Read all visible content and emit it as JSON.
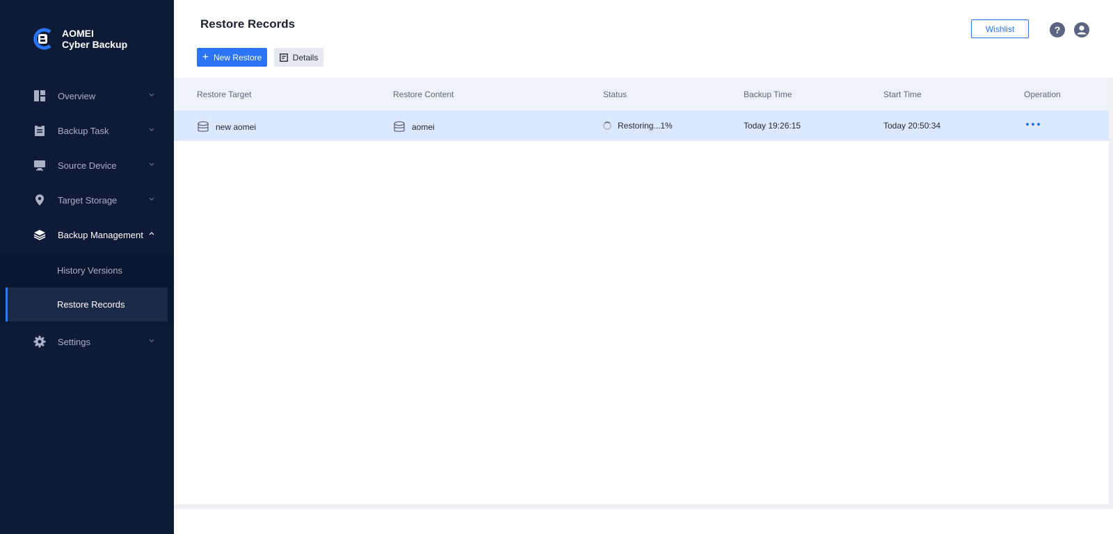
{
  "app": {
    "name_line1": "AOMEI",
    "name_line2": "Cyber Backup",
    "brand_color": "#2b73f5",
    "sidebar_bg": "#0e1a36"
  },
  "sidebar": {
    "items": [
      {
        "label": "Overview",
        "icon": "dashboard-icon"
      },
      {
        "label": "Backup Task",
        "icon": "clipboard-icon"
      },
      {
        "label": "Source Device",
        "icon": "monitor-icon"
      },
      {
        "label": "Target Storage",
        "icon": "location-pin-icon"
      },
      {
        "label": "Backup Management",
        "icon": "layers-icon",
        "expanded": true
      },
      {
        "label": "Settings",
        "icon": "gear-icon"
      }
    ],
    "subitems": [
      {
        "label": "History Versions"
      },
      {
        "label": "Restore Records",
        "active": true
      }
    ]
  },
  "header": {
    "title": "Restore Records",
    "new_restore_label": "New Restore",
    "details_label": "Details",
    "wishlist_label": "Wishlist"
  },
  "table": {
    "columns": [
      "Restore Target",
      "Restore Content",
      "Status",
      "Backup Time",
      "Start Time",
      "Operation"
    ],
    "rows": [
      {
        "restore_target": "new aomei",
        "restore_content": "aomei",
        "status": "Restoring...1%",
        "backup_time": "Today 19:26:15",
        "start_time": "Today 20:50:34"
      }
    ]
  }
}
